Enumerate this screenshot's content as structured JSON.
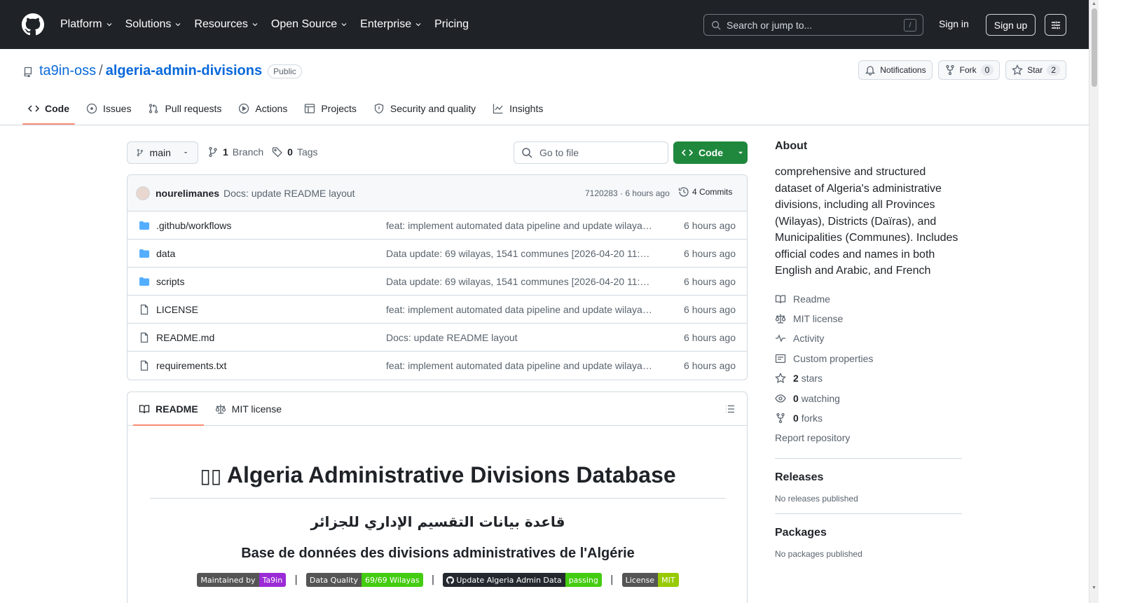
{
  "header": {
    "nav": [
      "Platform",
      "Solutions",
      "Resources",
      "Open Source",
      "Enterprise",
      "Pricing"
    ],
    "search_placeholder": "Search or jump to...",
    "slash_key": "/",
    "sign_in": "Sign in",
    "sign_up": "Sign up"
  },
  "repo": {
    "owner": "ta9in-oss",
    "separator": "/",
    "name": "algeria-admin-divisions",
    "visibility": "Public",
    "notifications": "Notifications",
    "fork_label": "Fork",
    "fork_count": "0",
    "star_label": "Star",
    "star_count": "2"
  },
  "tabs": [
    "Code",
    "Issues",
    "Pull requests",
    "Actions",
    "Projects",
    "Security and quality",
    "Insights"
  ],
  "branch_bar": {
    "branch": "main",
    "branch_count": "1",
    "branch_label": "Branch",
    "tag_count": "0",
    "tag_label": "Tags",
    "goto_placeholder": "Go to file",
    "code_button": "Code"
  },
  "latest_commit": {
    "author": "nourelimanes",
    "message": "Docs: update README layout",
    "sha_time": "7120283 · 6 hours ago",
    "commits": "4 Commits"
  },
  "files": [
    {
      "name": ".github/workflows",
      "type": "folder",
      "message": "feat: implement automated data pipeline and update wilayas…",
      "age": "6 hours ago"
    },
    {
      "name": "data",
      "type": "folder",
      "message": "Data update: 69 wilayas, 1541 communes [2026-04-20 11:…",
      "age": "6 hours ago"
    },
    {
      "name": "scripts",
      "type": "folder",
      "message": "Data update: 69 wilayas, 1541 communes [2026-04-20 11:…",
      "age": "6 hours ago"
    },
    {
      "name": "LICENSE",
      "type": "file",
      "message": "feat: implement automated data pipeline and update wilayas…",
      "age": "6 hours ago"
    },
    {
      "name": "README.md",
      "type": "file",
      "message": "Docs: update README layout",
      "age": "6 hours ago"
    },
    {
      "name": "requirements.txt",
      "type": "file",
      "message": "feat: implement automated data pipeline and update wilayas…",
      "age": "6 hours ago"
    }
  ],
  "readme": {
    "tab_readme": "README",
    "tab_license": "MIT license",
    "title": "Algeria Administrative Divisions Database",
    "title_arabic": "قاعدة بيانات التقسيم الإداري للجزائر",
    "title_french": "Base de données des divisions administratives de l'Algérie",
    "badges": [
      {
        "label": "Maintained by",
        "value": "Ta9in",
        "color": "#9b2bd6"
      },
      {
        "label": "Data Quality",
        "value": "69/69 Wilayas",
        "color": "#4c1"
      },
      {
        "label": "Update Algeria Admin Data",
        "value": "passing",
        "color": "#4c1"
      },
      {
        "label": "License",
        "value": "MIT",
        "color": "#97ca00"
      }
    ],
    "separator": "|"
  },
  "sidebar": {
    "about_title": "About",
    "description": "comprehensive and structured dataset of Algeria's administrative divisions, including all Provinces (Wilayas), Districts (Daïras), and Municipalities (Communes). Includes official codes and names in both English and Arabic, and French",
    "links": {
      "readme": "Readme",
      "license": "MIT license",
      "activity": "Activity",
      "custom": "Custom properties",
      "stars_count": "2",
      "stars_label": "stars",
      "watching_count": "0",
      "watching_label": "watching",
      "forks_count": "0",
      "forks_label": "forks",
      "report": "Report repository"
    },
    "releases_title": "Releases",
    "releases_sub": "No releases published",
    "packages_title": "Packages",
    "packages_sub": "No packages published"
  },
  "colors": {
    "header_bg": "#1f2328",
    "link": "#0969da",
    "green_button": "#1f883d",
    "tab_underline": "#fd8c73",
    "folder_icon": "#54aeff"
  }
}
